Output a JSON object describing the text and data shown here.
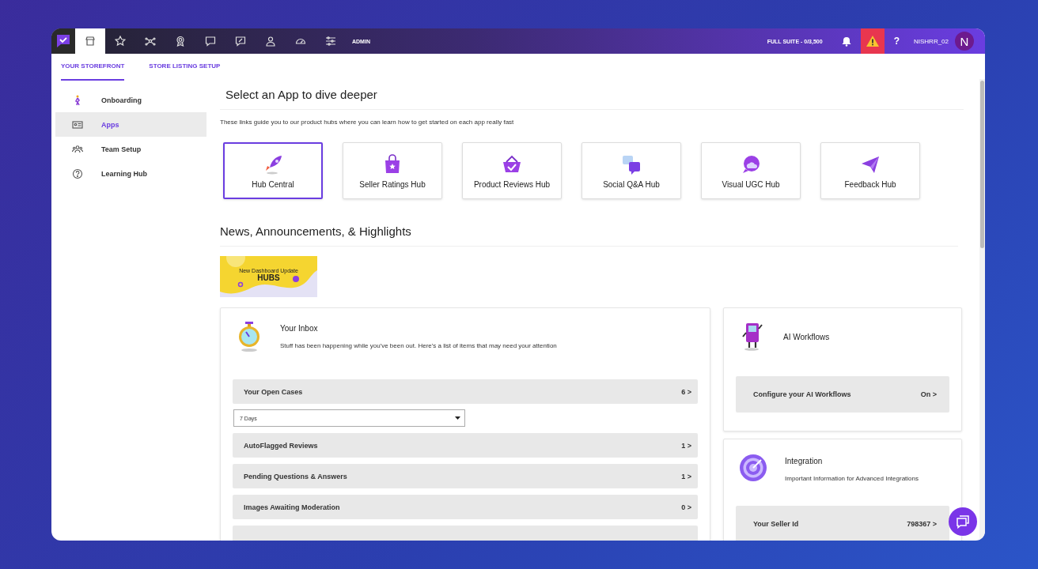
{
  "top_nav": {
    "items": [
      {
        "selected": true
      },
      {
        "selected": false
      },
      {
        "selected": false
      },
      {
        "selected": false
      },
      {
        "selected": false
      },
      {
        "selected": false
      },
      {
        "selected": false
      },
      {
        "selected": false
      },
      {
        "selected": false
      }
    ],
    "admin_label": "ADMIN",
    "plan": "FULL SUITE - 0/3,500",
    "help": "?",
    "username": "NISHRR_02",
    "avatar_initial": "N"
  },
  "tabs": [
    {
      "label": "YOUR STOREFRONT",
      "selected": true
    },
    {
      "label": "STORE LISTING SETUP",
      "selected": false
    }
  ],
  "sidebar": {
    "items": [
      {
        "label": "Onboarding",
        "selected": false
      },
      {
        "label": "Apps",
        "selected": true
      },
      {
        "label": "Team Setup",
        "selected": false
      },
      {
        "label": "Learning Hub",
        "selected": false
      }
    ]
  },
  "apps_section": {
    "title": "Select an App to dive deeper",
    "description": "These links guide you to our product hubs where you can learn how to get started on each app really fast",
    "hubs": [
      {
        "label": "Hub Central",
        "selected": true
      },
      {
        "label": "Seller Ratings Hub",
        "selected": false
      },
      {
        "label": "Product Reviews Hub",
        "selected": false
      },
      {
        "label": "Social Q&A Hub",
        "selected": false
      },
      {
        "label": "Visual UGC Hub",
        "selected": false
      },
      {
        "label": "Feedback Hub",
        "selected": false
      }
    ]
  },
  "news_section": {
    "title": "News, Announcements, & Highlights",
    "banner": {
      "subtitle": "New Dashboard Update",
      "title": "HUBS"
    }
  },
  "inbox": {
    "title": "Your Inbox",
    "description": "Stuff has been happening while you've been out. Here's a list of items that may need your attention",
    "open_cases": {
      "label": "Your Open Cases",
      "count": "6 >"
    },
    "period_select": {
      "value": "7 Days"
    },
    "rows": [
      {
        "label": "AutoFlagged Reviews",
        "count": "1 >"
      },
      {
        "label": "Pending Questions & Answers",
        "count": "1 >"
      },
      {
        "label": "Images Awaiting Moderation",
        "count": "0 >"
      }
    ]
  },
  "ai_workflows": {
    "title": "AI Workflows",
    "row": {
      "label": "Configure your AI Workflows",
      "value": "On >"
    }
  },
  "integration": {
    "title": "Integration",
    "description": "Important Information for Advanced Integrations",
    "row": {
      "label": "Your Seller Id",
      "value": "798367 >"
    }
  }
}
